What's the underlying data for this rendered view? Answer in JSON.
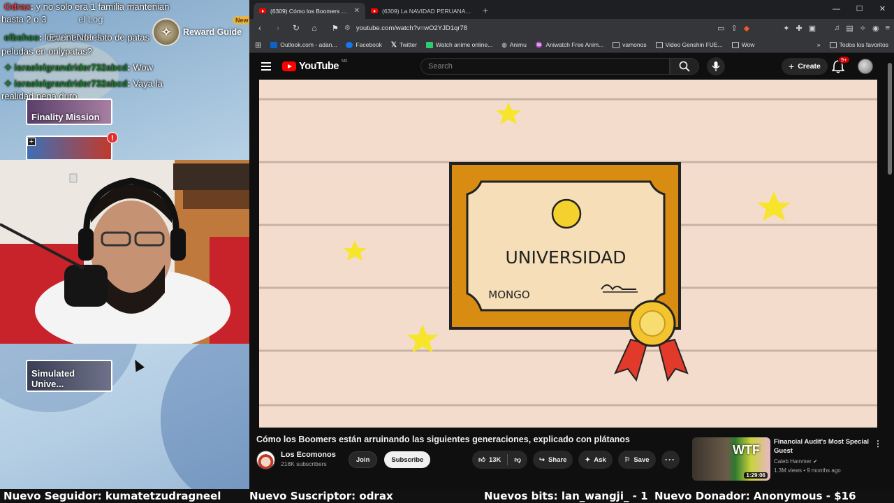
{
  "overlay": {
    "chat": [
      {
        "user": "Odrax",
        "message": "y no solo era 1 familia mantenian"
      },
      {
        "user": "",
        "message": "hasta 2 o 3"
      },
      {
        "user": "",
        "message": "Event Notes"
      },
      {
        "user": "elbshoo",
        "message": "locarinender foto de patas"
      },
      {
        "user": "",
        "message": "peludas en onlypatas?"
      },
      {
        "user": "israelelgrandrider732abcd",
        "message": "Wow"
      },
      {
        "user": "israelelgrandrider732abcd",
        "message": "Vaya la"
      },
      {
        "user": "",
        "message": "realidad pega duro"
      }
    ],
    "reward_guide": "Reward Guide",
    "new_badge": "New",
    "alert_mark": "!",
    "chip_finality": "Finality Mission",
    "chip_simulated": "Simulated Unive...",
    "log_label": "el Log"
  },
  "browser": {
    "tabs": [
      {
        "title": "(6309) Cómo los Boomers están",
        "active": true
      },
      {
        "title": "(6309) La NAVIDAD PERUANA es OTR",
        "active": false
      }
    ],
    "url": "youtube.com/watch?v=wO2YJD1qr78",
    "bookmarks": [
      {
        "label": "Outlook.com - adan...",
        "color": "#0a64c8"
      },
      {
        "label": "Facebook",
        "color": "#1877f2"
      },
      {
        "label": "Twitter",
        "color": "#000000"
      },
      {
        "label": "Watch anime online...",
        "color": "#2ecc71"
      },
      {
        "label": "Animu",
        "color": "#888888"
      },
      {
        "label": "Aniwatch Free Anim...",
        "color": "#888888"
      },
      {
        "label": "vamonos",
        "color": "folder"
      },
      {
        "label": "Video Genshin FUE...",
        "color": "folder"
      },
      {
        "label": "Wow",
        "color": "folder"
      }
    ],
    "all_bookmarks": "Todos los favoritos"
  },
  "youtube": {
    "logo": "YouTube",
    "region": "MX",
    "search_placeholder": "Search",
    "create_label": "Create",
    "notif_count": "9+",
    "video": {
      "frame_text_main": "UNIVERSIDAD",
      "frame_text_name": "MONGO",
      "title": "Cómo los Boomers están arruinando las siguientes generaciones, explicado con plátanos",
      "channel": "Los Ecomonos",
      "subscribers": "218K subscribers",
      "join": "Join",
      "subscribe": "Subscribe",
      "likes": "13K",
      "share": "Share",
      "ask": "Ask",
      "save": "Save"
    },
    "recommended": {
      "title": "Financial Audit's Most Special Guest",
      "channel": "Caleb Hammer",
      "meta": "1.3M views • 9 months ago",
      "duration": "1:29:06",
      "thumb_text": "WTF"
    }
  },
  "ticker": {
    "follower": "Nuevo Seguidor: kumatetzudragneel",
    "subscriber": "Nuevo Suscriptor: odrax",
    "bits": "Nuevos bits: lan_wangji_ - 1",
    "donor": "Nuevo Donador: Anonymous - $16"
  },
  "colors": {
    "yt_red": "#ff0000",
    "frame_orange": "#d88c12",
    "parchment": "#f5deb8",
    "star": "#f6e52b",
    "ribbon": "#e23a2a",
    "medal": "#f4c430"
  }
}
